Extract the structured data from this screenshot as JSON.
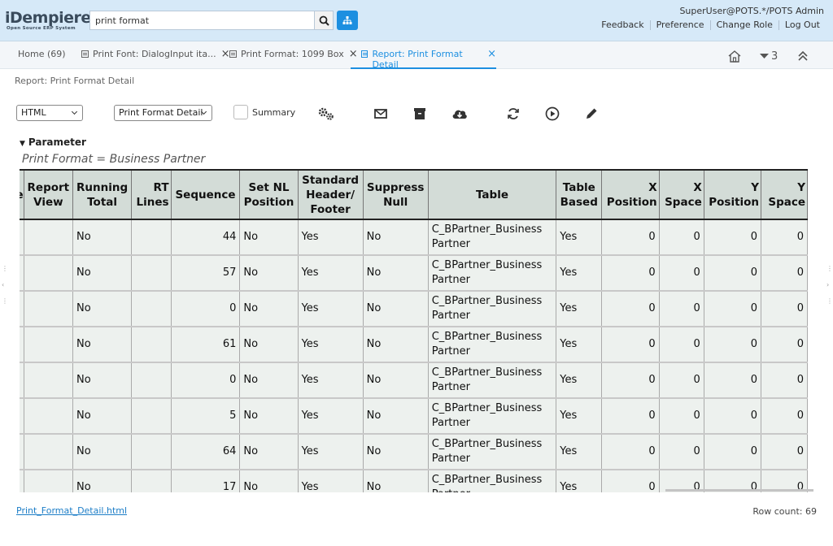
{
  "header": {
    "logo_main": "iDempiere",
    "logo_sub": "Open Source ERP System",
    "search_value": "print format",
    "user": "SuperUser@POTS.*/POTS Admin",
    "links": [
      "Feedback",
      "Preference",
      "Change Role",
      "Log Out"
    ]
  },
  "tabs": [
    {
      "label": "Home (69)"
    },
    {
      "label": "Print Font: DialogInput ita..."
    },
    {
      "label": "Print Format: 1099 Box"
    },
    {
      "label": "Report: Print Format Detail"
    }
  ],
  "tabbar_count": "3",
  "breadcrumb": "Report: Print Format Detail",
  "toolbar": {
    "output_format": "HTML",
    "print_format": "Print Format Detail",
    "summary_label": "Summary"
  },
  "parameter": {
    "title": "Parameter",
    "value": "Print Format = Business Partner"
  },
  "table": {
    "columns": [
      [
        "e",
        "Report",
        "Running",
        "RT",
        "Sequence",
        "Set NL",
        "Standard",
        "Suppress",
        "Table",
        "Table",
        "X",
        "X",
        "Y",
        "Y"
      ],
      [
        "e",
        "View",
        "Total",
        "Lines",
        "",
        "Position",
        "Header/",
        "Null",
        "",
        "Based",
        "Position",
        "Space",
        "Position",
        "Space"
      ]
    ],
    "header_labels": [
      "e",
      "Report View",
      "Running Total",
      "RT Lines",
      "Sequence",
      "Set NL Position",
      "Standard Header/ Footer",
      "Suppress Null",
      "Table",
      "Table Based",
      "X Position",
      "X Space",
      "Y Position",
      "Y Space"
    ],
    "rows": [
      {
        "running_total": "No",
        "sequence": "44",
        "set_nl": "No",
        "std_header": "Yes",
        "suppress": "No",
        "table": "C_BPartner_Business Partner",
        "table_based": "Yes",
        "x_pos": "0",
        "x_space": "0",
        "y_pos": "0",
        "y_space": "0"
      },
      {
        "running_total": "No",
        "sequence": "57",
        "set_nl": "No",
        "std_header": "Yes",
        "suppress": "No",
        "table": "C_BPartner_Business Partner",
        "table_based": "Yes",
        "x_pos": "0",
        "x_space": "0",
        "y_pos": "0",
        "y_space": "0"
      },
      {
        "running_total": "No",
        "sequence": "0",
        "set_nl": "No",
        "std_header": "Yes",
        "suppress": "No",
        "table": "C_BPartner_Business Partner",
        "table_based": "Yes",
        "x_pos": "0",
        "x_space": "0",
        "y_pos": "0",
        "y_space": "0"
      },
      {
        "running_total": "No",
        "sequence": "61",
        "set_nl": "No",
        "std_header": "Yes",
        "suppress": "No",
        "table": "C_BPartner_Business Partner",
        "table_based": "Yes",
        "x_pos": "0",
        "x_space": "0",
        "y_pos": "0",
        "y_space": "0"
      },
      {
        "running_total": "No",
        "sequence": "0",
        "set_nl": "No",
        "std_header": "Yes",
        "suppress": "No",
        "table": "C_BPartner_Business Partner",
        "table_based": "Yes",
        "x_pos": "0",
        "x_space": "0",
        "y_pos": "0",
        "y_space": "0"
      },
      {
        "running_total": "No",
        "sequence": "5",
        "set_nl": "No",
        "std_header": "Yes",
        "suppress": "No",
        "table": "C_BPartner_Business Partner",
        "table_based": "Yes",
        "x_pos": "0",
        "x_space": "0",
        "y_pos": "0",
        "y_space": "0"
      },
      {
        "running_total": "No",
        "sequence": "64",
        "set_nl": "No",
        "std_header": "Yes",
        "suppress": "No",
        "table": "C_BPartner_Business Partner",
        "table_based": "Yes",
        "x_pos": "0",
        "x_space": "0",
        "y_pos": "0",
        "y_space": "0"
      },
      {
        "running_total": "No",
        "sequence": "17",
        "set_nl": "No",
        "std_header": "Yes",
        "suppress": "No",
        "table": "C_BPartner_Business Partner",
        "table_based": "Yes",
        "x_pos": "0",
        "x_space": "0",
        "y_pos": "0",
        "y_space": "0"
      }
    ]
  },
  "footer": {
    "file_link": "Print_Format_Detail.html",
    "row_count": "Row count: 69"
  },
  "colors": {
    "accent": "#1d8fe0",
    "header_bg": "#d6e9f8",
    "table_header_bg": "#d3dcd7",
    "table_cell_bg": "#edf1ee"
  },
  "icons": [
    "search-icon",
    "tree-icon",
    "doc-icon",
    "close-icon",
    "home-icon",
    "chevron-down-icon",
    "collapse-up-icon",
    "gears-icon",
    "mail-icon",
    "archive-icon",
    "download-icon",
    "refresh-icon",
    "play-icon",
    "pencil-icon"
  ]
}
